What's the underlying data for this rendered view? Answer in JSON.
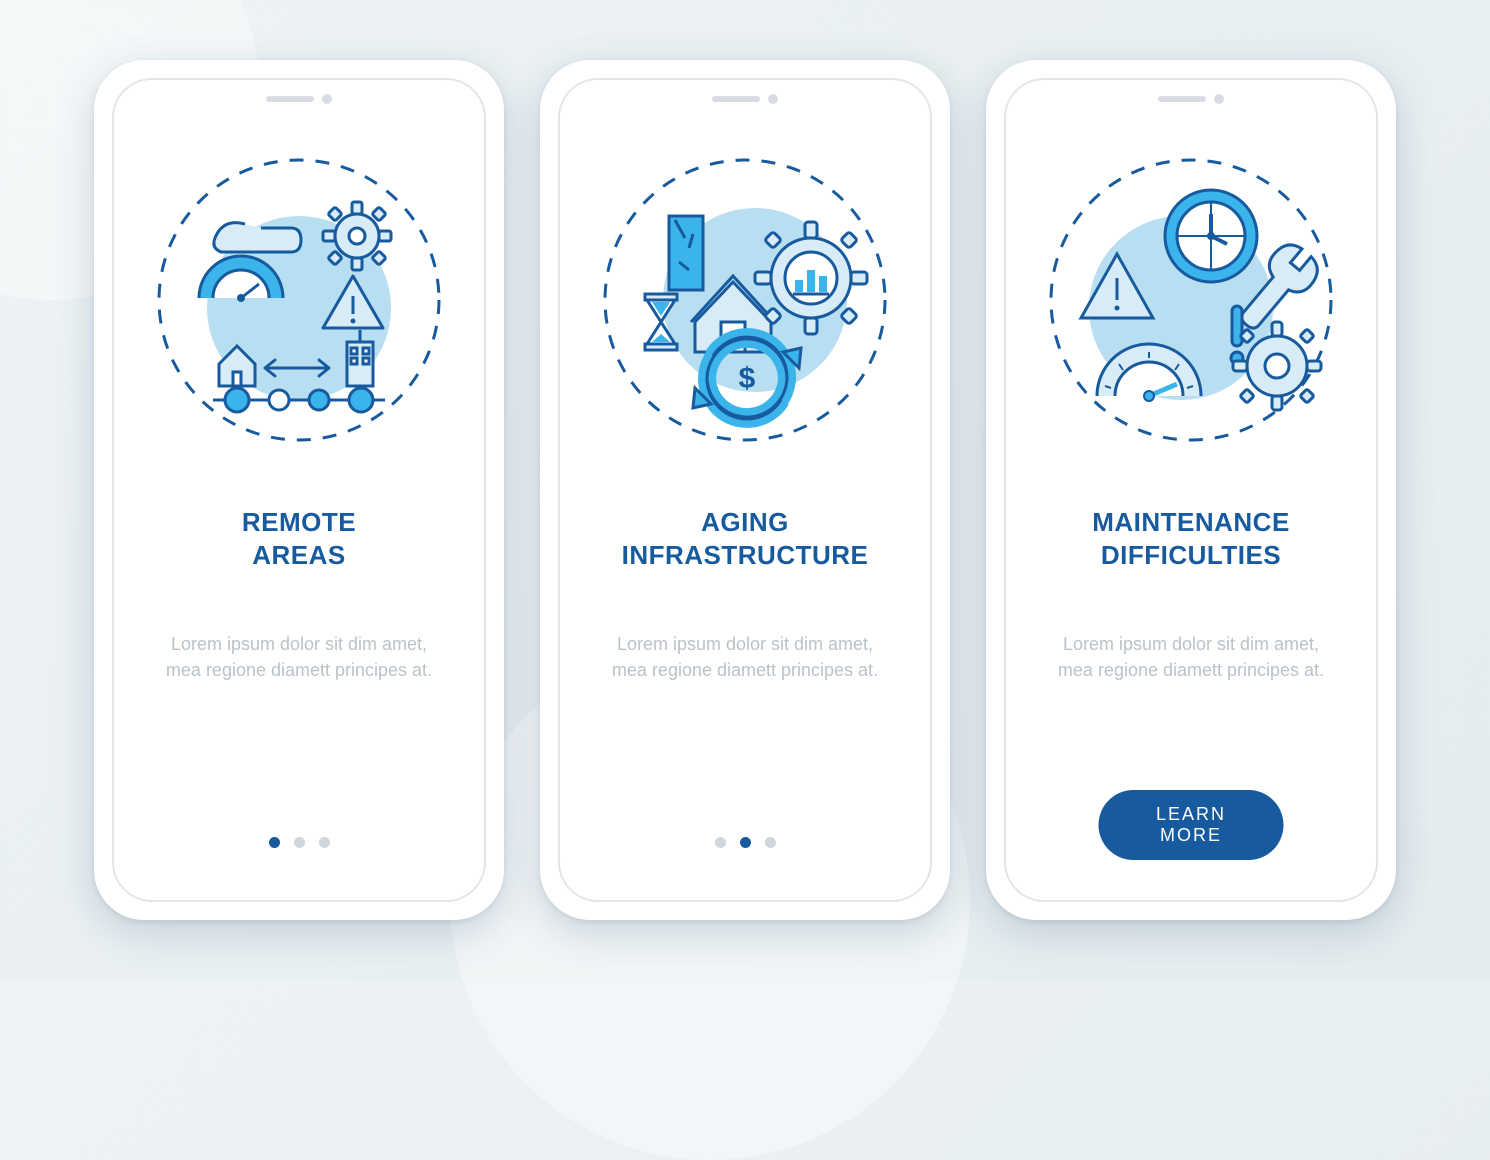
{
  "colors": {
    "primary": "#175a9e",
    "accent": "#3ab4ea",
    "light": "#b8def2",
    "muted": "#b9c2ca"
  },
  "screens": [
    {
      "title": "REMOTE\nAREAS",
      "body": "Lorem ipsum dolor sit dim amet, mea regione diamett principes at.",
      "icon": "remote-areas-icon",
      "active_dot": 0,
      "show_cta": false
    },
    {
      "title": "AGING\nINFRASTRUCTURE",
      "body": "Lorem ipsum dolor sit dim amet, mea regione diamett principes at.",
      "icon": "aging-infrastructure-icon",
      "active_dot": 1,
      "show_cta": false
    },
    {
      "title": "MAINTENANCE\nDIFFICULTIES",
      "body": "Lorem ipsum dolor sit dim amet, mea regione diamett principes at.",
      "icon": "maintenance-difficulties-icon",
      "active_dot": 2,
      "show_cta": true
    }
  ],
  "cta_label": "LEARN MORE",
  "dot_count": 3
}
